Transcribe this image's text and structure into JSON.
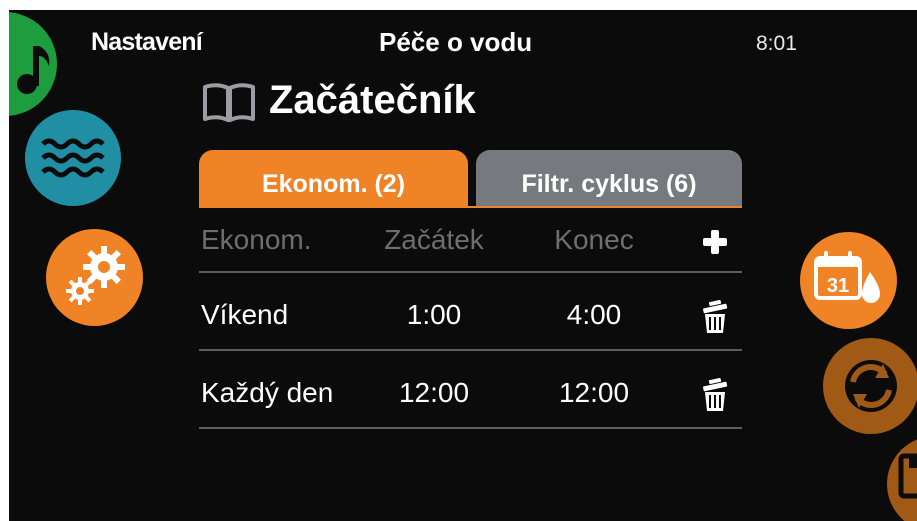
{
  "header": {
    "left_label": "Nastavení",
    "title": "Péče o vodu",
    "time": "8:01"
  },
  "page_title": "Začátečník",
  "tabs": [
    {
      "label": "Ekonom. (2)",
      "active": true
    },
    {
      "label": "Filtr. cyklus (6)",
      "active": false
    }
  ],
  "table": {
    "columns": [
      "Ekonom.",
      "Začátek",
      "Konec"
    ],
    "add_icon": "plus-icon",
    "rows": [
      {
        "name": "Víkend",
        "start": "1:00",
        "end": "4:00",
        "action_icon": "trash-icon"
      },
      {
        "name": "Každý den",
        "start": "12:00",
        "end": "12:00",
        "action_icon": "trash-icon"
      }
    ]
  },
  "side_buttons": {
    "calendar_day": "31"
  },
  "colors": {
    "accent": "#f08325",
    "inactive_tab": "#76797d",
    "background": "#0b0b0c",
    "music": "#1e9d3f",
    "water": "#208ea3",
    "dim_orange": "#a15916",
    "muted_text": "#6b6e72"
  }
}
